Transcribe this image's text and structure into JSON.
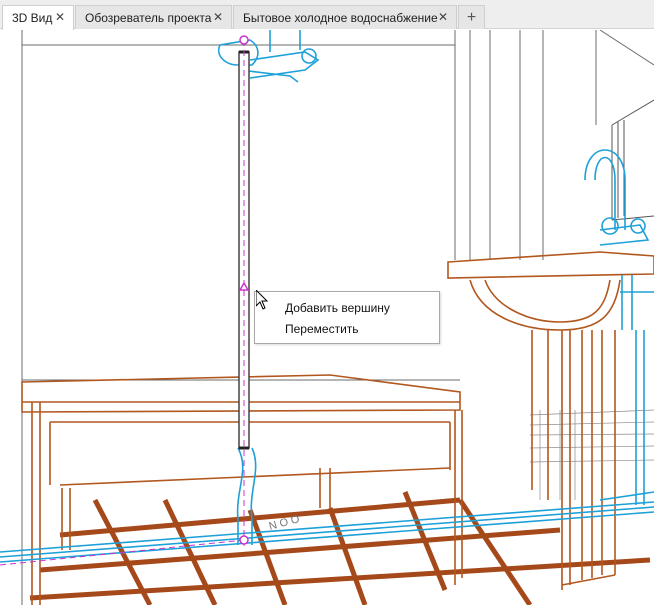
{
  "tabs": [
    {
      "label": "3D Вид",
      "close": "✕"
    },
    {
      "label": "Обозреватель проекта",
      "close": "✕"
    },
    {
      "label": "Бытовое холодное водоснабжение",
      "close": "✕"
    }
  ],
  "add_tab": "+",
  "context_menu": {
    "items": [
      "Добавить вершину",
      "Переместить"
    ]
  },
  "colors": {
    "furniture": "#b2571e",
    "floor_tile": "#a6491a",
    "pipe": "#1ea0d8",
    "selected_pipe": "#444444",
    "vertex": "#cc33cc",
    "walls": "#6b6b6b"
  },
  "icons": [
    "close-icon",
    "plus-icon",
    "mouse-cursor-icon",
    "vertex-marker-icon"
  ]
}
